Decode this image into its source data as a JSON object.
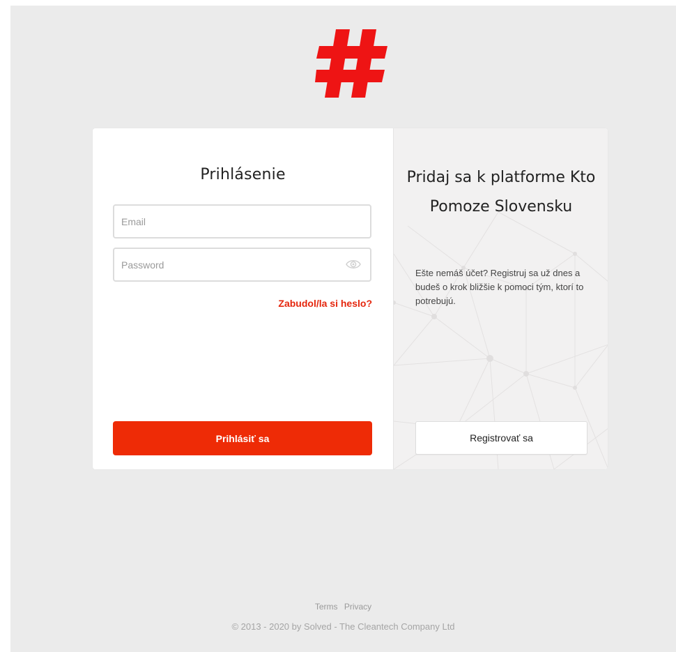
{
  "brand": {
    "logo_icon": "hashtag-logo-icon",
    "accent_color": "#ee2b06",
    "logo_color": "#ee1414"
  },
  "login": {
    "title": "Prihlásenie",
    "email_placeholder": "Email",
    "email_value": "",
    "password_placeholder": "Password",
    "password_value": "",
    "show_password_icon": "eye-icon",
    "forgot_label": "Zabudol/la si heslo?",
    "submit_label": "Prihlásiť sa"
  },
  "signup": {
    "title": "Pridaj sa k platforme Kto Pomoze Slovensku",
    "description": "Ešte nemáš účet? Registruj sa už dnes a budeš o krok bližšie k pomoci tým, ktorí to potrebujú.",
    "register_label": "Registrovať sa"
  },
  "footer": {
    "terms_label": "Terms",
    "privacy_label": "Privacy",
    "copyright": "© 2013 - 2020 by Solved - The Cleantech Company Ltd"
  }
}
